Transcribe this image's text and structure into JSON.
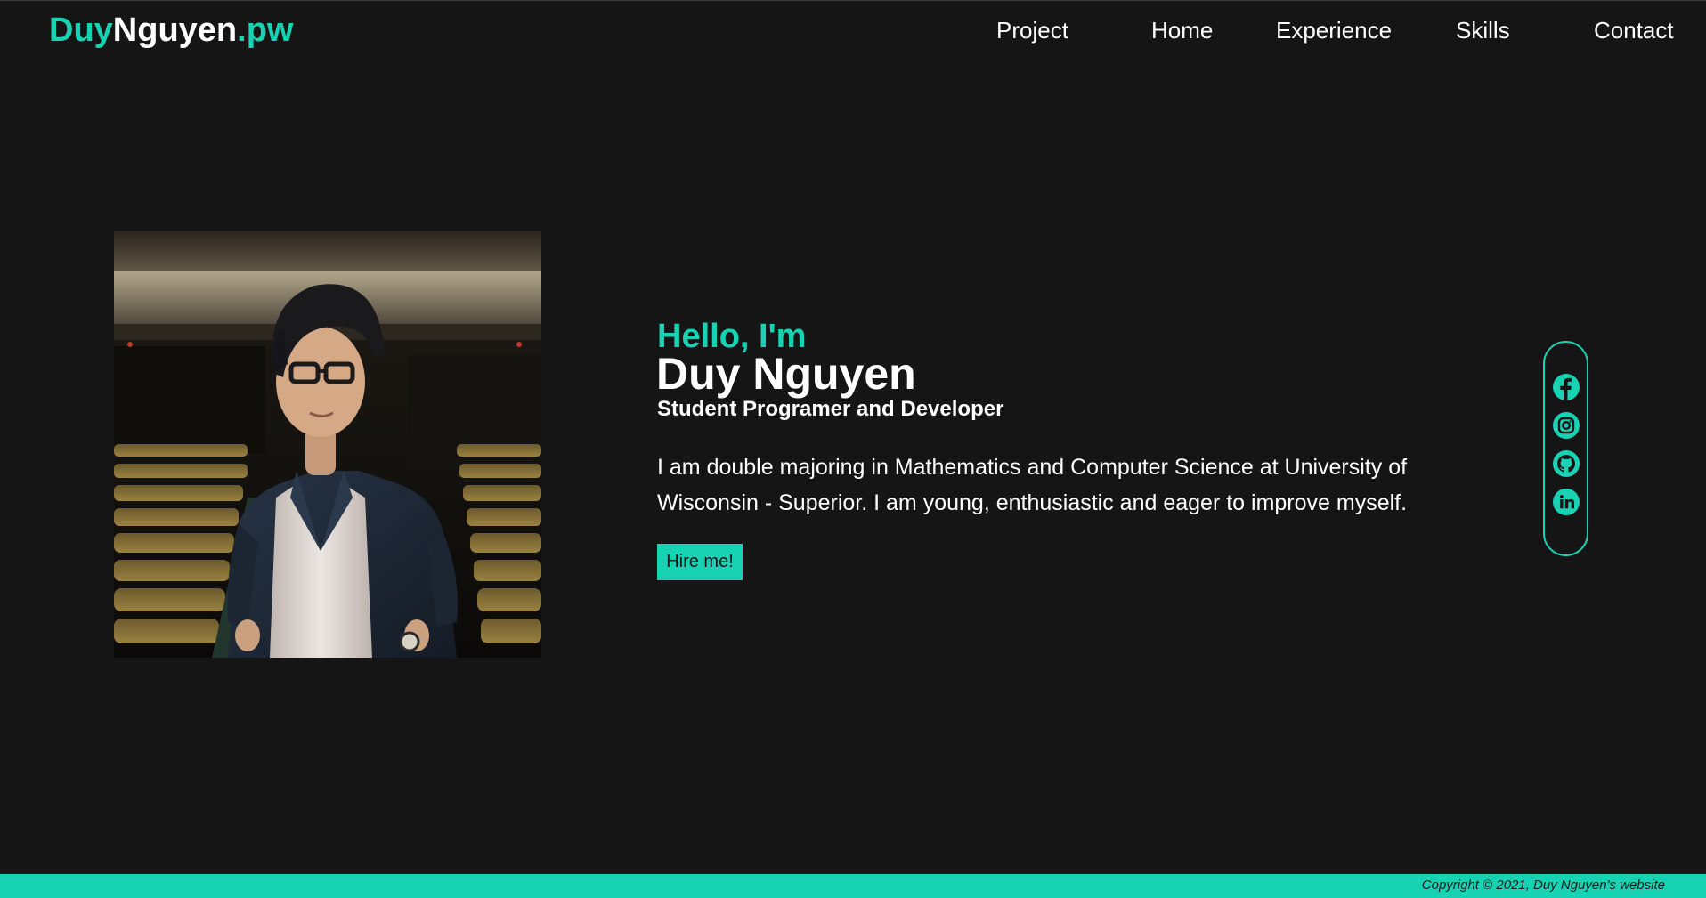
{
  "header": {
    "logo": {
      "part1": "Duy",
      "part2": "Nguyen",
      "part3": ".pw"
    },
    "nav": [
      {
        "label": "Project"
      },
      {
        "label": "Home"
      },
      {
        "label": "Experience"
      },
      {
        "label": "Skills"
      },
      {
        "label": "Contact"
      }
    ]
  },
  "hero": {
    "photo_alt": "Photo of Duy Nguyen standing in an auditorium",
    "greeting": "Hello, I'm",
    "name": "Duy Nguyen",
    "role": "Student Programer and Developer",
    "bio": "I am double majoring in Mathematics and Computer Science at University of Wisconsin - Superior. I am young, enthusiastic and eager to improve myself.",
    "cta_label": "Hire me!"
  },
  "social": [
    {
      "name": "Facebook",
      "icon": "facebook-icon"
    },
    {
      "name": "Instagram",
      "icon": "instagram-icon"
    },
    {
      "name": "GitHub",
      "icon": "github-icon"
    },
    {
      "name": "LinkedIn",
      "icon": "linkedin-icon"
    }
  ],
  "footer": {
    "copyright": "Copyright © 2021, Duy Nguyen's website"
  },
  "colors": {
    "accent": "#18d3b3",
    "background": "#151515",
    "text": "#ffffff"
  }
}
